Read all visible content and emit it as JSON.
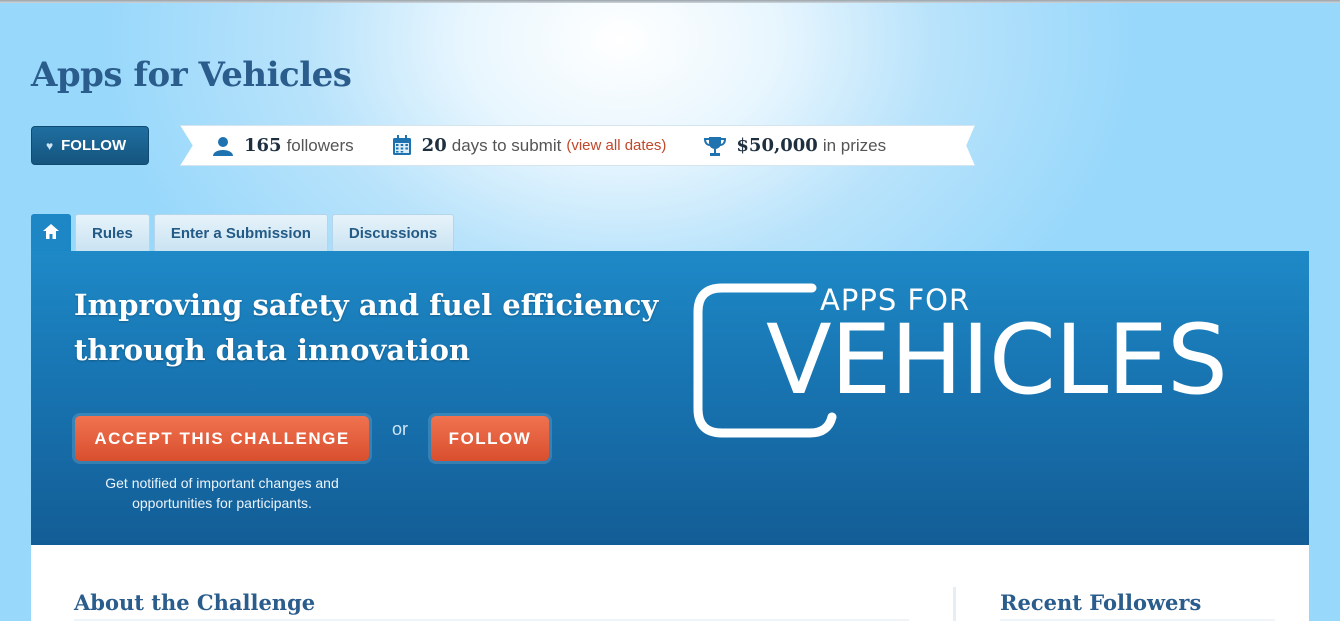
{
  "page": {
    "title": "Apps for Vehicles"
  },
  "header": {
    "follow_button": "FOLLOW",
    "stats": {
      "followers_count": "165",
      "followers_label": "followers",
      "days_count": "20",
      "days_label": "days to submit",
      "dates_link": "(view all dates)",
      "prize_amount": "$50,000",
      "prize_label": "in prizes"
    }
  },
  "tabs": [
    {
      "label": "Rules"
    },
    {
      "label": "Enter a Submission"
    },
    {
      "label": "Discussions"
    }
  ],
  "hero": {
    "headline": "Improving safety and fuel efficiency through data innovation",
    "accept_button": "ACCEPT THIS CHALLENGE",
    "or_text": "or",
    "follow_button": "FOLLOW",
    "notify_text": "Get notified of important changes and opportunities for participants.",
    "logo_top": "APPS FOR",
    "logo_main": "VEHICLES"
  },
  "content": {
    "about_title": "About the Challenge",
    "followers_title": "Recent Followers"
  },
  "colors": {
    "accent_blue": "#1d86c4",
    "title_blue": "#2a5c8c",
    "orange": "#e2603d",
    "link_red": "#c0472a"
  },
  "icons": [
    "heart-icon",
    "user-icon",
    "calendar-icon",
    "trophy-icon",
    "home-icon"
  ]
}
